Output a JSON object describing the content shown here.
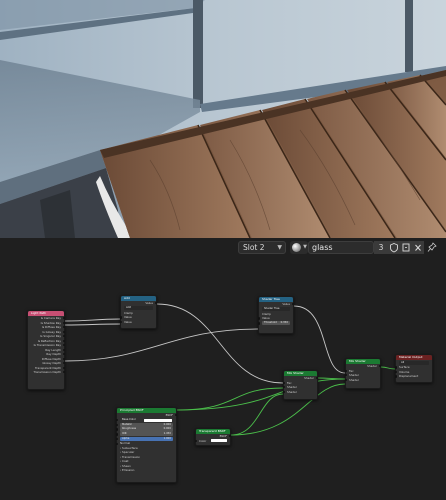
{
  "header": {
    "slot_label": "Slot 2",
    "material_name": "glass",
    "user_count": "3",
    "icons": [
      "material-sphere-icon",
      "shield-icon",
      "duplicate-icon",
      "delete-icon",
      "pin-icon"
    ]
  },
  "nodes": {
    "light_path": {
      "title": "Light Path",
      "header_color": "#c74f73",
      "outputs": [
        "Is Camera Ray",
        "Is Shadow Ray",
        "Is Diffuse Ray",
        "Is Glossy Ray",
        "Is Singular Ray",
        "Is Reflection Ray",
        "Is Transmission Ray",
        "Ray Length",
        "Ray Depth",
        "Diffuse Depth",
        "Glossy Depth",
        "Transparent Depth",
        "Transmission Depth"
      ]
    },
    "math": {
      "title": "Add",
      "header_color": "#246283",
      "output": "Value",
      "operation": "Add",
      "clamp": "Clamp",
      "inputs": [
        "Value",
        "Value"
      ]
    },
    "shader_to_rgb": {
      "title": "Shader Tree",
      "header_color": "#246283",
      "outputs": [
        "Value"
      ],
      "mode": "Shader Tree",
      "clamp": "Clamp",
      "inputs": [
        "Value"
      ],
      "threshold_label": "Threshold",
      "threshold_value": "0.350"
    },
    "mix_shader_1": {
      "title": "Mix Shader",
      "header_color": "#1b7a32",
      "output": "Shader",
      "inputs": [
        "Fac",
        "Shader",
        "Shader"
      ]
    },
    "mix_shader_2": {
      "title": "Mix Shader",
      "header_color": "#1b7a32",
      "output": "Shader",
      "inputs": [
        "Fac",
        "Shader",
        "Shader"
      ]
    },
    "material_output": {
      "title": "Material Output",
      "header_color": "#6b2121",
      "target": "All",
      "inputs": [
        "Surface",
        "Volume",
        "Displacement"
      ]
    },
    "principled": {
      "title": "Principled BSDF",
      "header_color": "#1b7a32",
      "output": "BSDF",
      "rows": [
        {
          "label": "Base Color",
          "value": ""
        },
        {
          "label": "Metallic",
          "value": "0.000"
        },
        {
          "label": "Roughness",
          "value": "0.000"
        },
        {
          "label": "IOR",
          "value": "1.450"
        },
        {
          "label": "Alpha",
          "value": "1.000"
        },
        {
          "label": "Normal",
          "value": ""
        }
      ],
      "sections": [
        "Subsurface",
        "Specular",
        "Transmission",
        "Coat",
        "Sheen",
        "Emission"
      ]
    },
    "transparent": {
      "title": "Transparent BSDF",
      "header_color": "#1b7a32",
      "output": "BSDF",
      "input": "Color"
    }
  }
}
